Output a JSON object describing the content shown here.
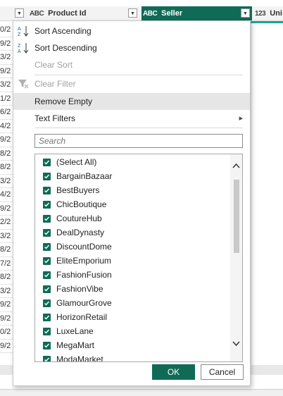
{
  "grid": {
    "columns": [
      {
        "type_icon": "ABC",
        "name": "Product Id"
      },
      {
        "type_icon": "ABC",
        "name": "Seller"
      },
      {
        "type_icon": "123",
        "name": "Uni"
      }
    ],
    "left_cells": [
      "0/2",
      "9/2",
      "3/2",
      "9/2",
      "3/2",
      "1/2",
      "6/2",
      "4/2",
      "9/2",
      "8/2",
      "8/2",
      "3/2",
      "4/2",
      "9/2",
      "2/2",
      "3/2",
      "8/2",
      "7/2",
      "8/2",
      "3/2",
      "9/2",
      "9/2",
      "0/2",
      "9/2"
    ]
  },
  "menu": {
    "items": [
      {
        "label": "Sort Ascending",
        "icon": "sort-ascending-icon",
        "disabled": false
      },
      {
        "label": "Sort Descending",
        "icon": "sort-descending-icon",
        "disabled": false
      },
      {
        "label": "Clear Sort",
        "disabled": true
      },
      {
        "label": "Clear Filter",
        "icon": "clear-filter-icon",
        "disabled": true
      },
      {
        "label": "Remove Empty",
        "disabled": false,
        "highlighted": true
      },
      {
        "label": "Text Filters",
        "disabled": false,
        "submenu": true
      }
    ],
    "search_placeholder": "Search",
    "list_items": [
      "(Select All)",
      "BargainBazaar",
      "BestBuyers",
      "ChicBoutique",
      "CoutureHub",
      "DealDynasty",
      "DiscountDome",
      "EliteEmporium",
      "FashionFusion",
      "FashionVibe",
      "GlamourGrove",
      "HorizonRetail",
      "LuxeLane",
      "MegaMart",
      "ModaMarket"
    ],
    "ok_label": "OK",
    "cancel_label": "Cancel"
  },
  "colors": {
    "accent": "#0f6b56",
    "header_underline": "#13a892"
  }
}
